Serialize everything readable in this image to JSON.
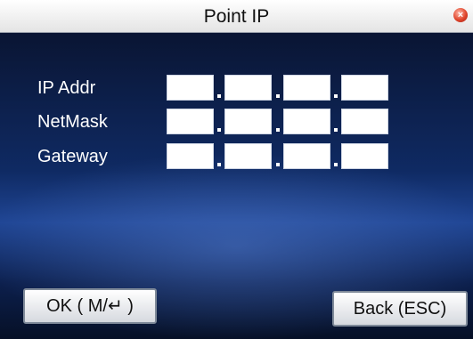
{
  "window": {
    "title": "Point IP",
    "close_icon": "close-icon"
  },
  "fields": [
    {
      "label": "IP Addr",
      "octets": [
        "",
        "",
        "",
        ""
      ]
    },
    {
      "label": "NetMask",
      "octets": [
        "",
        "",
        "",
        ""
      ]
    },
    {
      "label": "Gateway",
      "octets": [
        "",
        "",
        "",
        ""
      ]
    }
  ],
  "buttons": {
    "ok_label": "OK ( M/↵ )",
    "back_label": "Back (ESC)"
  },
  "colors": {
    "screen_bg": "#0f2a63",
    "title_bg": "#ffffff",
    "close": "#e0452c"
  }
}
